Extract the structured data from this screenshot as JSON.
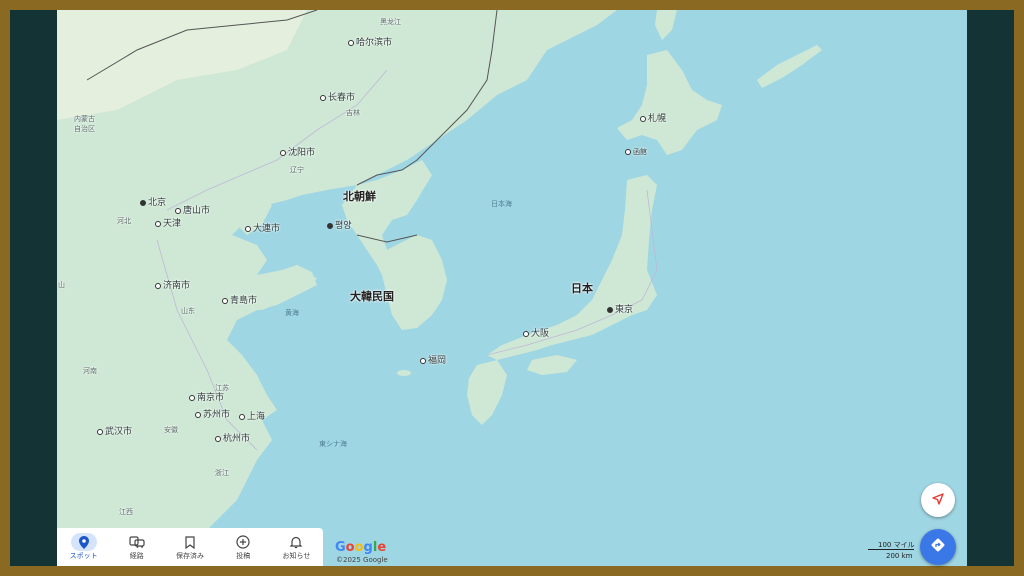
{
  "map": {
    "cities": [
      {
        "id": "harbin",
        "name": "哈尔滨市",
        "type": "city"
      },
      {
        "id": "changchun",
        "name": "长春市",
        "type": "city"
      },
      {
        "id": "shenyang",
        "name": "沈阳市",
        "type": "city"
      },
      {
        "id": "beijing",
        "name": "北京",
        "type": "capital"
      },
      {
        "id": "tangshan",
        "name": "唐山市",
        "type": "city"
      },
      {
        "id": "tianjin",
        "name": "天津",
        "type": "city"
      },
      {
        "id": "dalian",
        "name": "大連市",
        "type": "city"
      },
      {
        "id": "pyongyang",
        "name": "평양",
        "type": "capital"
      },
      {
        "id": "jinan",
        "name": "济南市",
        "type": "city"
      },
      {
        "id": "qingdao",
        "name": "青島市",
        "type": "city"
      },
      {
        "id": "nanjing",
        "name": "南京市",
        "type": "city"
      },
      {
        "id": "suzhou",
        "name": "苏州市",
        "type": "city"
      },
      {
        "id": "shanghai",
        "name": "上海",
        "type": "city"
      },
      {
        "id": "hangzhou",
        "name": "杭州市",
        "type": "city"
      },
      {
        "id": "wuhan",
        "name": "武汉市",
        "type": "city"
      },
      {
        "id": "sapporo",
        "name": "札幌",
        "type": "city"
      },
      {
        "id": "hakodate",
        "name": "函館",
        "type": "city"
      },
      {
        "id": "tokyo",
        "name": "東京",
        "type": "capital"
      },
      {
        "id": "osaka",
        "name": "大阪",
        "type": "city"
      },
      {
        "id": "fukuoka",
        "name": "福岡",
        "type": "city"
      }
    ],
    "countries": [
      {
        "id": "north_korea",
        "name": "北朝鮮"
      },
      {
        "id": "south_korea",
        "name": "大韓民国"
      },
      {
        "id": "japan",
        "name": "日本"
      }
    ],
    "seas": [
      {
        "id": "sea_of_japan",
        "name": "日本海"
      },
      {
        "id": "yellow_sea",
        "name": "黄海"
      },
      {
        "id": "east_china_sea",
        "name": "東シナ海"
      }
    ],
    "regions": [
      {
        "id": "heilongjiang",
        "name": "黑龙江"
      },
      {
        "id": "jilin",
        "name": "吉林"
      },
      {
        "id": "liaoning",
        "name": "辽宁"
      },
      {
        "id": "inner_mongolia",
        "name": "内蒙古\n自治区"
      },
      {
        "id": "hebei",
        "name": "河北"
      },
      {
        "id": "shandong",
        "name": "山东"
      },
      {
        "id": "henan",
        "name": "河南"
      },
      {
        "id": "jiangsu",
        "name": "江苏"
      },
      {
        "id": "anhui",
        "name": "安徽"
      },
      {
        "id": "zhejiang",
        "name": "浙江"
      },
      {
        "id": "jiangxi",
        "name": "江西"
      },
      {
        "id": "shanxi_short",
        "name": "山"
      }
    ]
  },
  "nav": {
    "items": [
      {
        "label": "スポット",
        "icon": "location-pin-icon",
        "active": true
      },
      {
        "label": "経路",
        "icon": "commute-icon",
        "active": false
      },
      {
        "label": "保存済み",
        "icon": "bookmark-icon",
        "active": false
      },
      {
        "label": "投稿",
        "icon": "add-circle-icon",
        "active": false
      },
      {
        "label": "お知らせ",
        "icon": "bell-icon",
        "active": false
      }
    ]
  },
  "footer": {
    "logo": "Google",
    "copyright": "©2025 Google",
    "scale_miles": "100 マイル",
    "scale_km": "200 km"
  },
  "buttons": {
    "navigate_icon": "navigation-arrow-icon",
    "directions_icon": "directions-icon"
  },
  "colors": {
    "water": "#9fd6e3",
    "land": "#cfe8d5",
    "accent": "#1a56c8",
    "directions_fab": "#3b78e7",
    "frame": "#8a6a22",
    "background": "#143335"
  }
}
